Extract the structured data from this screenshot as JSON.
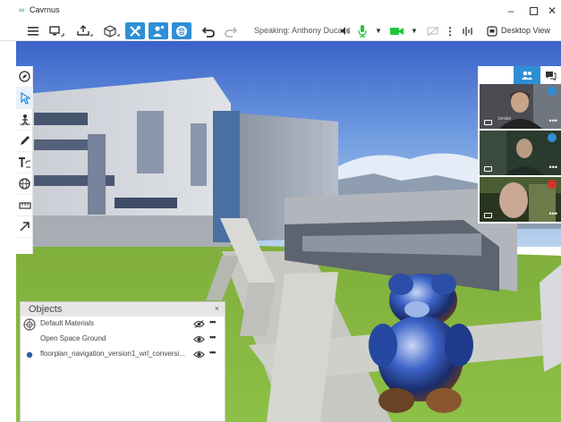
{
  "window": {
    "title": "Cavrnus",
    "minimize_icon": "minimize-icon",
    "maximize_icon": "maximize-icon",
    "close_icon": "close-icon"
  },
  "toolbar": {
    "items": [
      {
        "name": "menu-icon",
        "active": false
      },
      {
        "name": "screen-share-icon",
        "active": false
      },
      {
        "name": "upload-icon",
        "active": false
      },
      {
        "name": "objects-cube-icon",
        "active": false
      },
      {
        "name": "tools-icon",
        "active": true
      },
      {
        "name": "user-position-icon",
        "active": true
      },
      {
        "name": "layers-icon",
        "active": true
      },
      {
        "name": "undo-icon",
        "active": false
      },
      {
        "name": "redo-icon",
        "active": false
      }
    ],
    "speaking_label": "Speaking: Anthony Duca",
    "desktop_view_label": "Desktop View",
    "accent_color": "#2f8fd6",
    "mic_color": "#22c43a",
    "camera_color": "#22c43a"
  },
  "left_tools": [
    {
      "name": "compass-icon",
      "active": false
    },
    {
      "name": "select-cursor-icon",
      "active": true
    },
    {
      "name": "navigate-person-icon",
      "active": false
    },
    {
      "name": "pencil-icon",
      "active": false
    },
    {
      "name": "text-tool-icon",
      "active": false
    },
    {
      "name": "sphere-icon",
      "active": false
    },
    {
      "name": "measure-icon",
      "active": false
    },
    {
      "name": "arrow-icon",
      "active": false
    }
  ],
  "video_panel": {
    "tabs": [
      {
        "name": "participants-icon",
        "active": true
      },
      {
        "name": "chat-icon",
        "active": false
      }
    ],
    "participants": [
      {
        "name": "Jordan",
        "mic": "on",
        "mic_color": "#2f8fd6"
      },
      {
        "name": "",
        "mic": "on",
        "mic_color": "#2f8fd6"
      },
      {
        "name": "",
        "mic": "muted",
        "mic_color": "#d9302c"
      }
    ]
  },
  "objects_panel": {
    "title": "Objects",
    "close_label": "×",
    "rows": [
      {
        "label": "Default Materials",
        "icon": "materials-sphere-icon",
        "visibility": "hidden-eye-icon",
        "more": "•••"
      },
      {
        "label": "Open Space Ground",
        "icon": "",
        "visibility": "eye-icon",
        "more": "•••"
      },
      {
        "label": "floorplan_navigation_version1_wrl_conversi...",
        "icon": "model-dot-icon",
        "visibility": "eye-icon",
        "more": "•••"
      }
    ]
  }
}
